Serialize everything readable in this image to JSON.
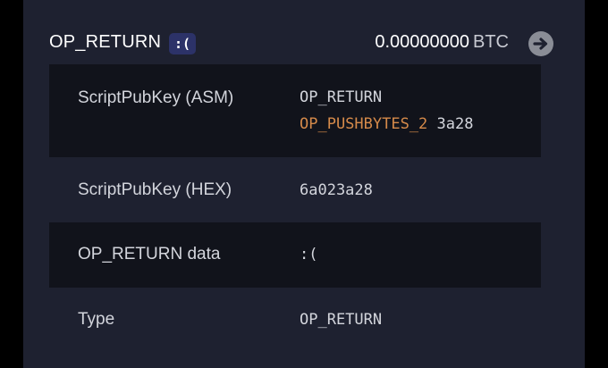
{
  "output": {
    "title": "OP_RETURN",
    "badge": ":(",
    "amount": "0.00000000",
    "unit": "BTC",
    "arrow_icon": "arrow-right-circle-icon"
  },
  "rows": {
    "asm": {
      "label": "ScriptPubKey (ASM)",
      "op1": "OP_RETURN",
      "op2": "OP_PUSHBYTES_2",
      "op2_data": "3a28"
    },
    "hex": {
      "label": "ScriptPubKey (HEX)",
      "value": "6a023a28"
    },
    "data": {
      "label": "OP_RETURN data",
      "value": ":("
    },
    "type": {
      "label": "Type",
      "value": "OP_RETURN"
    }
  },
  "colors": {
    "background": "#1e2130",
    "row_dark": "#11131b",
    "badge": "#2c3268",
    "opcode_blue": "#8e9fc4",
    "opcode_orange": "#d58a4a"
  }
}
